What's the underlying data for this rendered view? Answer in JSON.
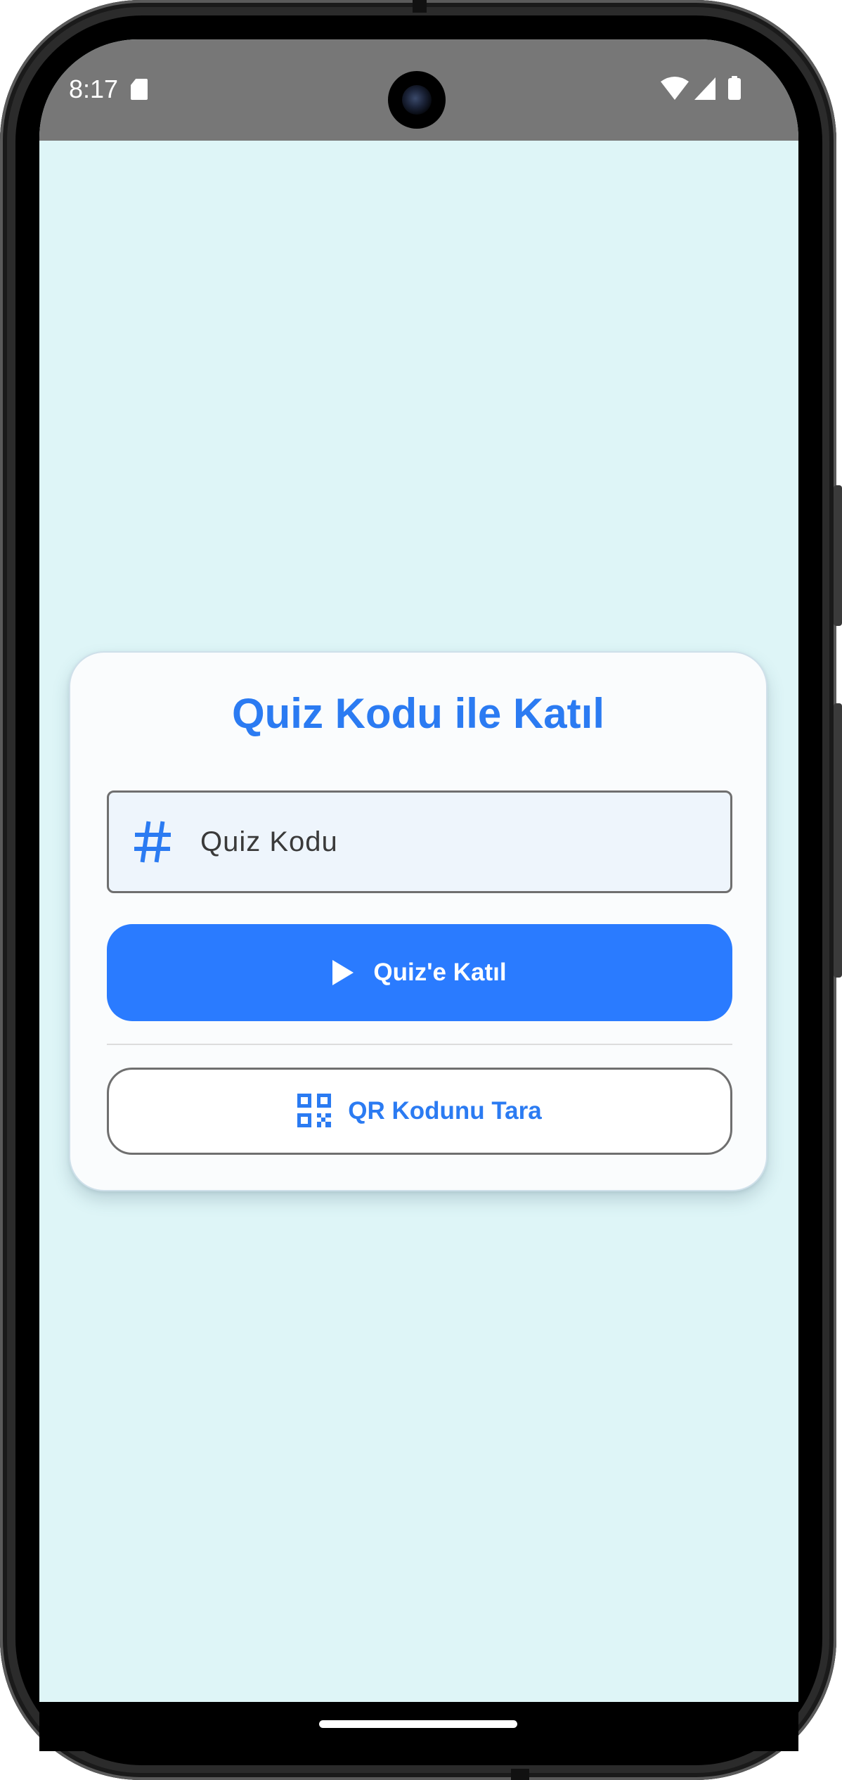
{
  "status_bar": {
    "time": "8:17",
    "icons": [
      "sd-card-icon",
      "wifi-icon",
      "cellular-signal-icon",
      "battery-icon"
    ]
  },
  "join_card": {
    "title": "Quiz Kodu ile Katıl",
    "code_input": {
      "icon": "hash-icon",
      "placeholder": "Quiz Kodu",
      "value": ""
    },
    "join_button": {
      "icon": "play-icon",
      "label": "Quiz'e Katıl"
    },
    "qr_button": {
      "icon": "qr-code-icon",
      "label": "QR Kodunu Tara"
    }
  },
  "colors": {
    "accent": "#2a7bff",
    "title": "#2b7bf2",
    "screen_background": "#def5f7",
    "card_background": "#fafcfd",
    "input_background": "#eef5fc",
    "status_bar": "#777777"
  }
}
